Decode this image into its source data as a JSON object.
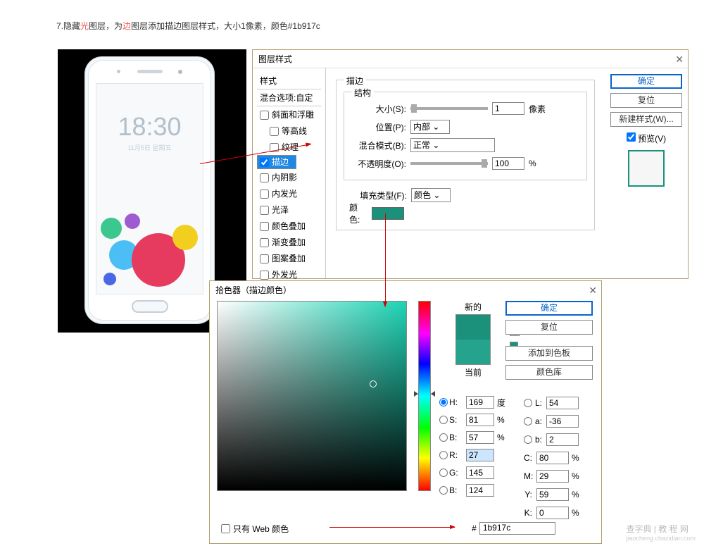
{
  "instruction": {
    "prefix": "7.隐藏",
    "red1": "光",
    "mid1": "图层，为",
    "red2": "边",
    "mid2": "图层添加描边图层样式，大小1像素，颜色#1b917c"
  },
  "phone": {
    "time": "18:30",
    "date": "11月5日 星期五"
  },
  "layerStyle": {
    "title": "图层样式",
    "stylesHeader": "样式",
    "blendHeader": "混合选项:自定",
    "items": [
      "斜面和浮雕",
      "等高线",
      "纹理",
      "描边",
      "内阴影",
      "内发光",
      "光泽",
      "颜色叠加",
      "渐变叠加",
      "图案叠加",
      "外发光"
    ],
    "selectedIndex": 3,
    "strokeGroup": "描边",
    "structGroup": "结构",
    "sizeLabel": "大小(S):",
    "sizeValue": "1",
    "sizeUnit": "像素",
    "posLabel": "位置(P):",
    "posValue": "内部",
    "blendLabel": "混合模式(B):",
    "blendValue": "正常",
    "opacityLabel": "不透明度(O):",
    "opacityValue": "100",
    "opacityUnit": "%",
    "fillTypeLabel": "填充类型(F):",
    "fillTypeValue": "颜色",
    "colorLabel": "颜色:",
    "ok": "确定",
    "reset": "复位",
    "newStyle": "新建样式(W)...",
    "preview": "预览(V)"
  },
  "picker": {
    "title": "拾色器（描边颜色）",
    "new": "新的",
    "current": "当前",
    "ok": "确定",
    "cancel": "复位",
    "addSwatch": "添加到色板",
    "colorLib": "颜色库",
    "H": "169",
    "Hu": "度",
    "S": "81",
    "Su": "%",
    "Bv": "57",
    "Bu": "%",
    "R": "27",
    "G": "145",
    "B": "124",
    "L": "54",
    "a": "-36",
    "b": "2",
    "C": "80",
    "M": "29",
    "Y": "59",
    "K": "0",
    "CMu": "%",
    "webonly": "只有 Web 颜色",
    "hashLabel": "#",
    "hex": "1b917c"
  },
  "watermark": {
    "main": "查字典 | 教 程 网",
    "sub": "jiaocheng.chazidian.com"
  }
}
